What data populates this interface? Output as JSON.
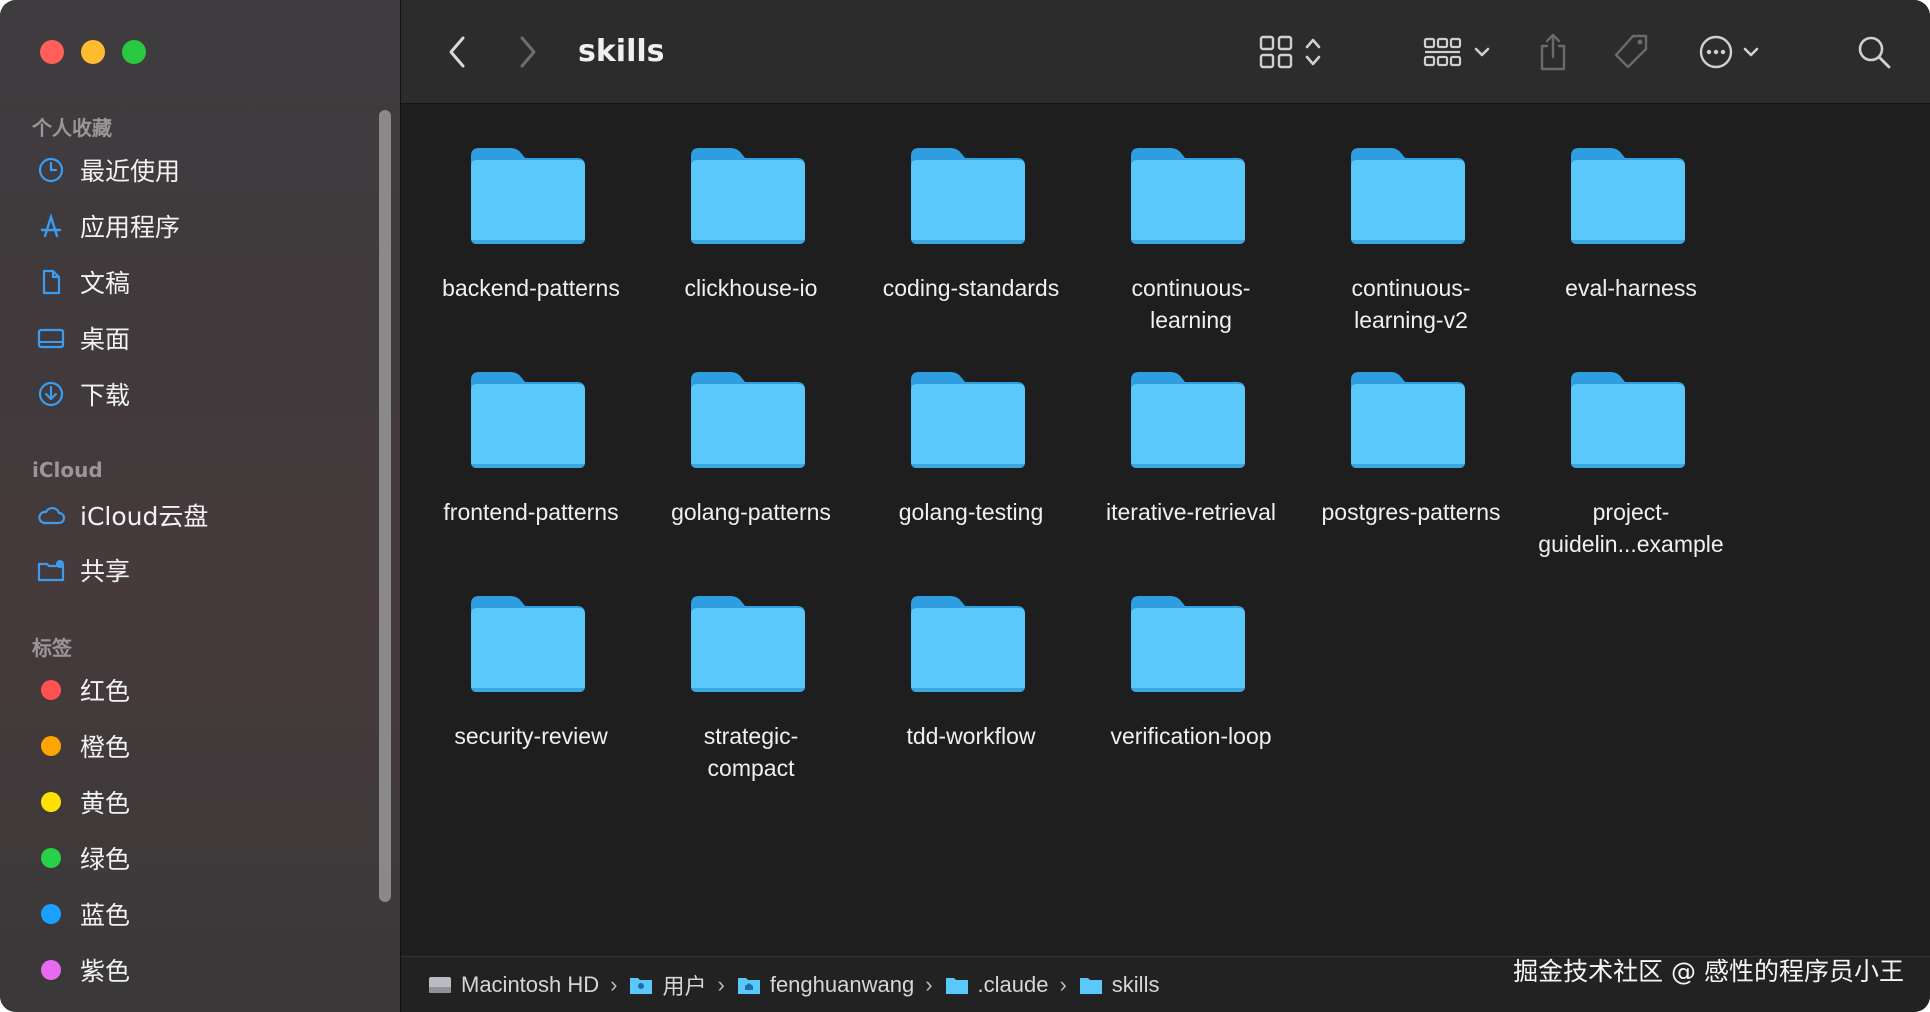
{
  "window": {
    "title": "skills"
  },
  "sidebar": {
    "sections": [
      {
        "label": "个人收藏"
      },
      {
        "label": "iCloud"
      },
      {
        "label": "标签"
      }
    ],
    "favorites": [
      {
        "label": "最近使用",
        "icon": "clock-icon"
      },
      {
        "label": "应用程序",
        "icon": "applications-icon"
      },
      {
        "label": "文稿",
        "icon": "document-icon"
      },
      {
        "label": "桌面",
        "icon": "desktop-icon"
      },
      {
        "label": "下载",
        "icon": "download-icon"
      }
    ],
    "icloud": [
      {
        "label": "iCloud云盘",
        "icon": "cloud-icon"
      },
      {
        "label": "共享",
        "icon": "shared-folder-icon"
      }
    ],
    "tags": [
      {
        "label": "红色",
        "color": "#fe5151"
      },
      {
        "label": "橙色",
        "color": "#ffa500"
      },
      {
        "label": "黄色",
        "color": "#ffe000"
      },
      {
        "label": "绿色",
        "color": "#28d14a"
      },
      {
        "label": "蓝色",
        "color": "#1aa0ff"
      },
      {
        "label": "紫色",
        "color": "#e86af0"
      }
    ]
  },
  "toolbar": {
    "back": "chevron-left-icon",
    "forward": "chevron-right-icon",
    "view": "grid-view-icon",
    "group": "group-icon",
    "share": "share-icon",
    "tag": "tag-icon",
    "more": "more-icon",
    "search": "search-icon"
  },
  "files": [
    {
      "name": "backend-patterns"
    },
    {
      "name": "clickhouse-io"
    },
    {
      "name": "coding-standards"
    },
    {
      "name": "continuous-\nlearning"
    },
    {
      "name": "continuous-\nlearning-v2"
    },
    {
      "name": "eval-harness"
    },
    {
      "name": "frontend-patterns"
    },
    {
      "name": "golang-patterns"
    },
    {
      "name": "golang-testing"
    },
    {
      "name": "iterative-retrieval"
    },
    {
      "name": "postgres-patterns"
    },
    {
      "name": "project-\nguidelin...example"
    },
    {
      "name": "security-review"
    },
    {
      "name": "strategic-\ncompact"
    },
    {
      "name": "tdd-workflow"
    },
    {
      "name": "verification-loop"
    }
  ],
  "path": [
    {
      "label": "Macintosh HD",
      "icon": "hard-drive-icon"
    },
    {
      "label": "用户",
      "icon": "users-folder-icon"
    },
    {
      "label": "fenghuanwang",
      "icon": "home-folder-icon"
    },
    {
      "label": ".claude",
      "icon": "folder-icon"
    },
    {
      "label": "skills",
      "icon": "folder-icon"
    }
  ],
  "watermark": "掘金技术社区 @ 感性的程序员小王",
  "colors": {
    "folder": "#5ac8fa",
    "accent": "#3b9cf0"
  }
}
